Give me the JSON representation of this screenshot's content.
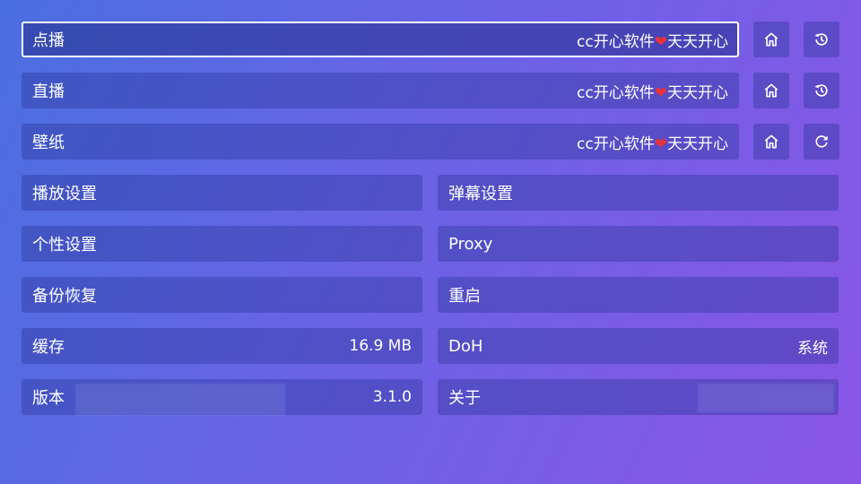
{
  "sites": [
    {
      "label": "点播",
      "value_prefix": "cc开心软件",
      "heart": "❤",
      "value_suffix": "天天开心",
      "action_icon": "history-icon"
    },
    {
      "label": "直播",
      "value_prefix": "cc开心软件",
      "heart": "❤",
      "value_suffix": "天天开心",
      "action_icon": "history-icon"
    },
    {
      "label": "壁纸",
      "value_prefix": "cc开心软件",
      "heart": "❤",
      "value_suffix": "天天开心",
      "action_icon": "refresh-icon"
    }
  ],
  "settings": {
    "play": "播放设置",
    "danmaku": "弹幕设置",
    "personal": "个性设置",
    "proxy": "Proxy",
    "backup": "备份恢复",
    "restart": "重启",
    "cache": {
      "label": "缓存",
      "value": "16.9 MB"
    },
    "doh": {
      "label": "DoH",
      "value": "系统"
    },
    "version": {
      "label": "版本",
      "value": "3.1.0"
    },
    "about": {
      "label": "关于"
    }
  }
}
